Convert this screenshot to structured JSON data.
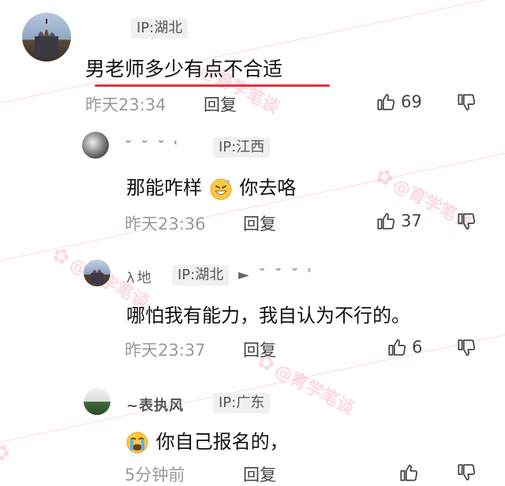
{
  "comments": [
    {
      "ip": "IP:湖北",
      "content": "男老师多少有点不合适",
      "time": "昨天23:34",
      "reply": "回复",
      "likes": "69"
    },
    {
      "username": "˘ ˘ ˘ ʿ",
      "ip": "IP:江西",
      "content_text": "那能咋样",
      "content_tail": "你去咯",
      "emoji": "grinning-sweat-emoji",
      "time": "昨天23:36",
      "reply": "回复",
      "likes": "37"
    },
    {
      "username_left": "λ地",
      "ip": "IP:湖北",
      "username_right": "► ˘ ˘ ˘ ʿ",
      "content": "哪怕我有能力，我自认为不行的。",
      "time": "昨天23:37",
      "reply": "回复",
      "likes": "6"
    },
    {
      "username": "~表执风",
      "ip": "IP:广东",
      "emoji": "crying-emoji",
      "content": "你自己报名的，",
      "time": "5分钟前",
      "reply": "回复"
    }
  ],
  "watermark": {
    "text": "@育学笔谈",
    "color": "#eb506e"
  },
  "colors": {
    "underline": "#e4333d",
    "meta_text": "#9a9a9a"
  }
}
